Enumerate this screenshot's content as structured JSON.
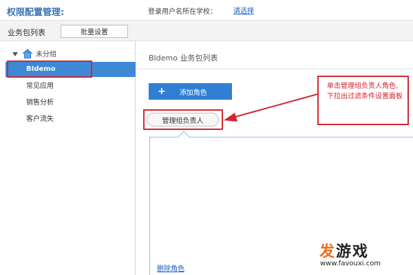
{
  "header": {
    "title": "权限配置管理:",
    "login_text": "登录用户名所在学校：",
    "login_link": "请选择"
  },
  "toolbar": {
    "label": "业务包列表",
    "batch_button": "批量设置"
  },
  "sidebar": {
    "root": "未分组",
    "items": [
      {
        "label": "BIdemo",
        "selected": true
      },
      {
        "label": "常见应用"
      },
      {
        "label": "销售分析"
      },
      {
        "label": "客户流失"
      }
    ]
  },
  "content": {
    "panel_title": "BIdemo 业务包列表",
    "add_role_button": "添加角色",
    "add_role_icon": "+",
    "manager_button": "管理组负责人",
    "delete_role_link": "删除角色"
  },
  "annotation": {
    "callout_text": "单击管理组负责人角色,下拉出过滤条件设置面板"
  },
  "watermark": {
    "logo_main": "发",
    "logo_rest": "游戏",
    "url": "www.favouxi.com"
  },
  "colors": {
    "accent_blue": "#2f7fd2",
    "selected_blue": "#3e89d6",
    "annotation_red": "#d3262f",
    "title_blue": "#3a72b8"
  }
}
